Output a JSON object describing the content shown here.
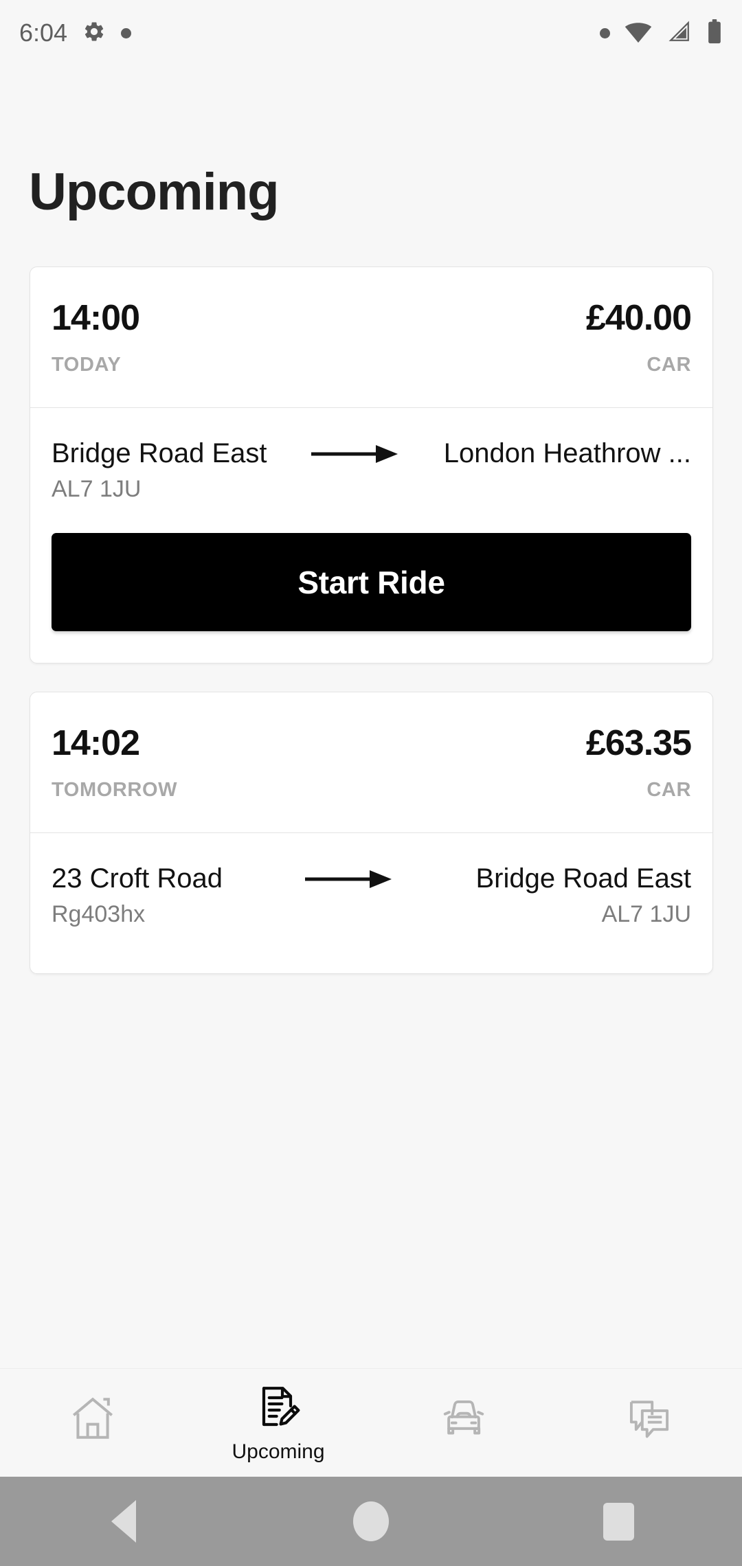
{
  "status_bar": {
    "time": "6:04",
    "left_icons": [
      "gear-icon",
      "dot-icon"
    ],
    "right_icons": [
      "dot-icon",
      "wifi-icon",
      "cellular-signal-icon",
      "battery-icon"
    ]
  },
  "header": {
    "title": "Upcoming"
  },
  "rides": [
    {
      "time": "14:00",
      "price": "£40.00",
      "day": "TODAY",
      "vehicle": "CAR",
      "pickup": "Bridge Road East",
      "pickup_code": "AL7 1JU",
      "dropoff": "London Heathrow ...",
      "dropoff_code": "",
      "action_label": "Start Ride",
      "has_action": true
    },
    {
      "time": "14:02",
      "price": "£63.35",
      "day": "TOMORROW",
      "vehicle": "CAR",
      "pickup": "23 Croft Road",
      "pickup_code": "Rg403hx",
      "dropoff": "Bridge Road East",
      "dropoff_code": "AL7 1JU",
      "action_label": "",
      "has_action": false
    }
  ],
  "bottom_nav": {
    "items": [
      {
        "icon": "home-icon",
        "label": "",
        "active": false
      },
      {
        "icon": "document-pencil-icon",
        "label": "Upcoming",
        "active": true
      },
      {
        "icon": "car-icon",
        "label": "",
        "active": false
      },
      {
        "icon": "chat-bubbles-icon",
        "label": "",
        "active": false
      }
    ]
  },
  "android_nav": {
    "back": "back-triangle-icon",
    "home": "home-circle-icon",
    "recents": "recents-square-icon"
  },
  "colors": {
    "background": "#f7f7f7",
    "card": "#ffffff",
    "card_border": "#e3e3e3",
    "primary_text": "#111111",
    "muted_text": "#a8a8a8",
    "code_text": "#7d7d7d",
    "accent_button": "#000000",
    "android_nav_bg": "#9a9a9a",
    "nav_inactive": "#b5b5b5"
  }
}
